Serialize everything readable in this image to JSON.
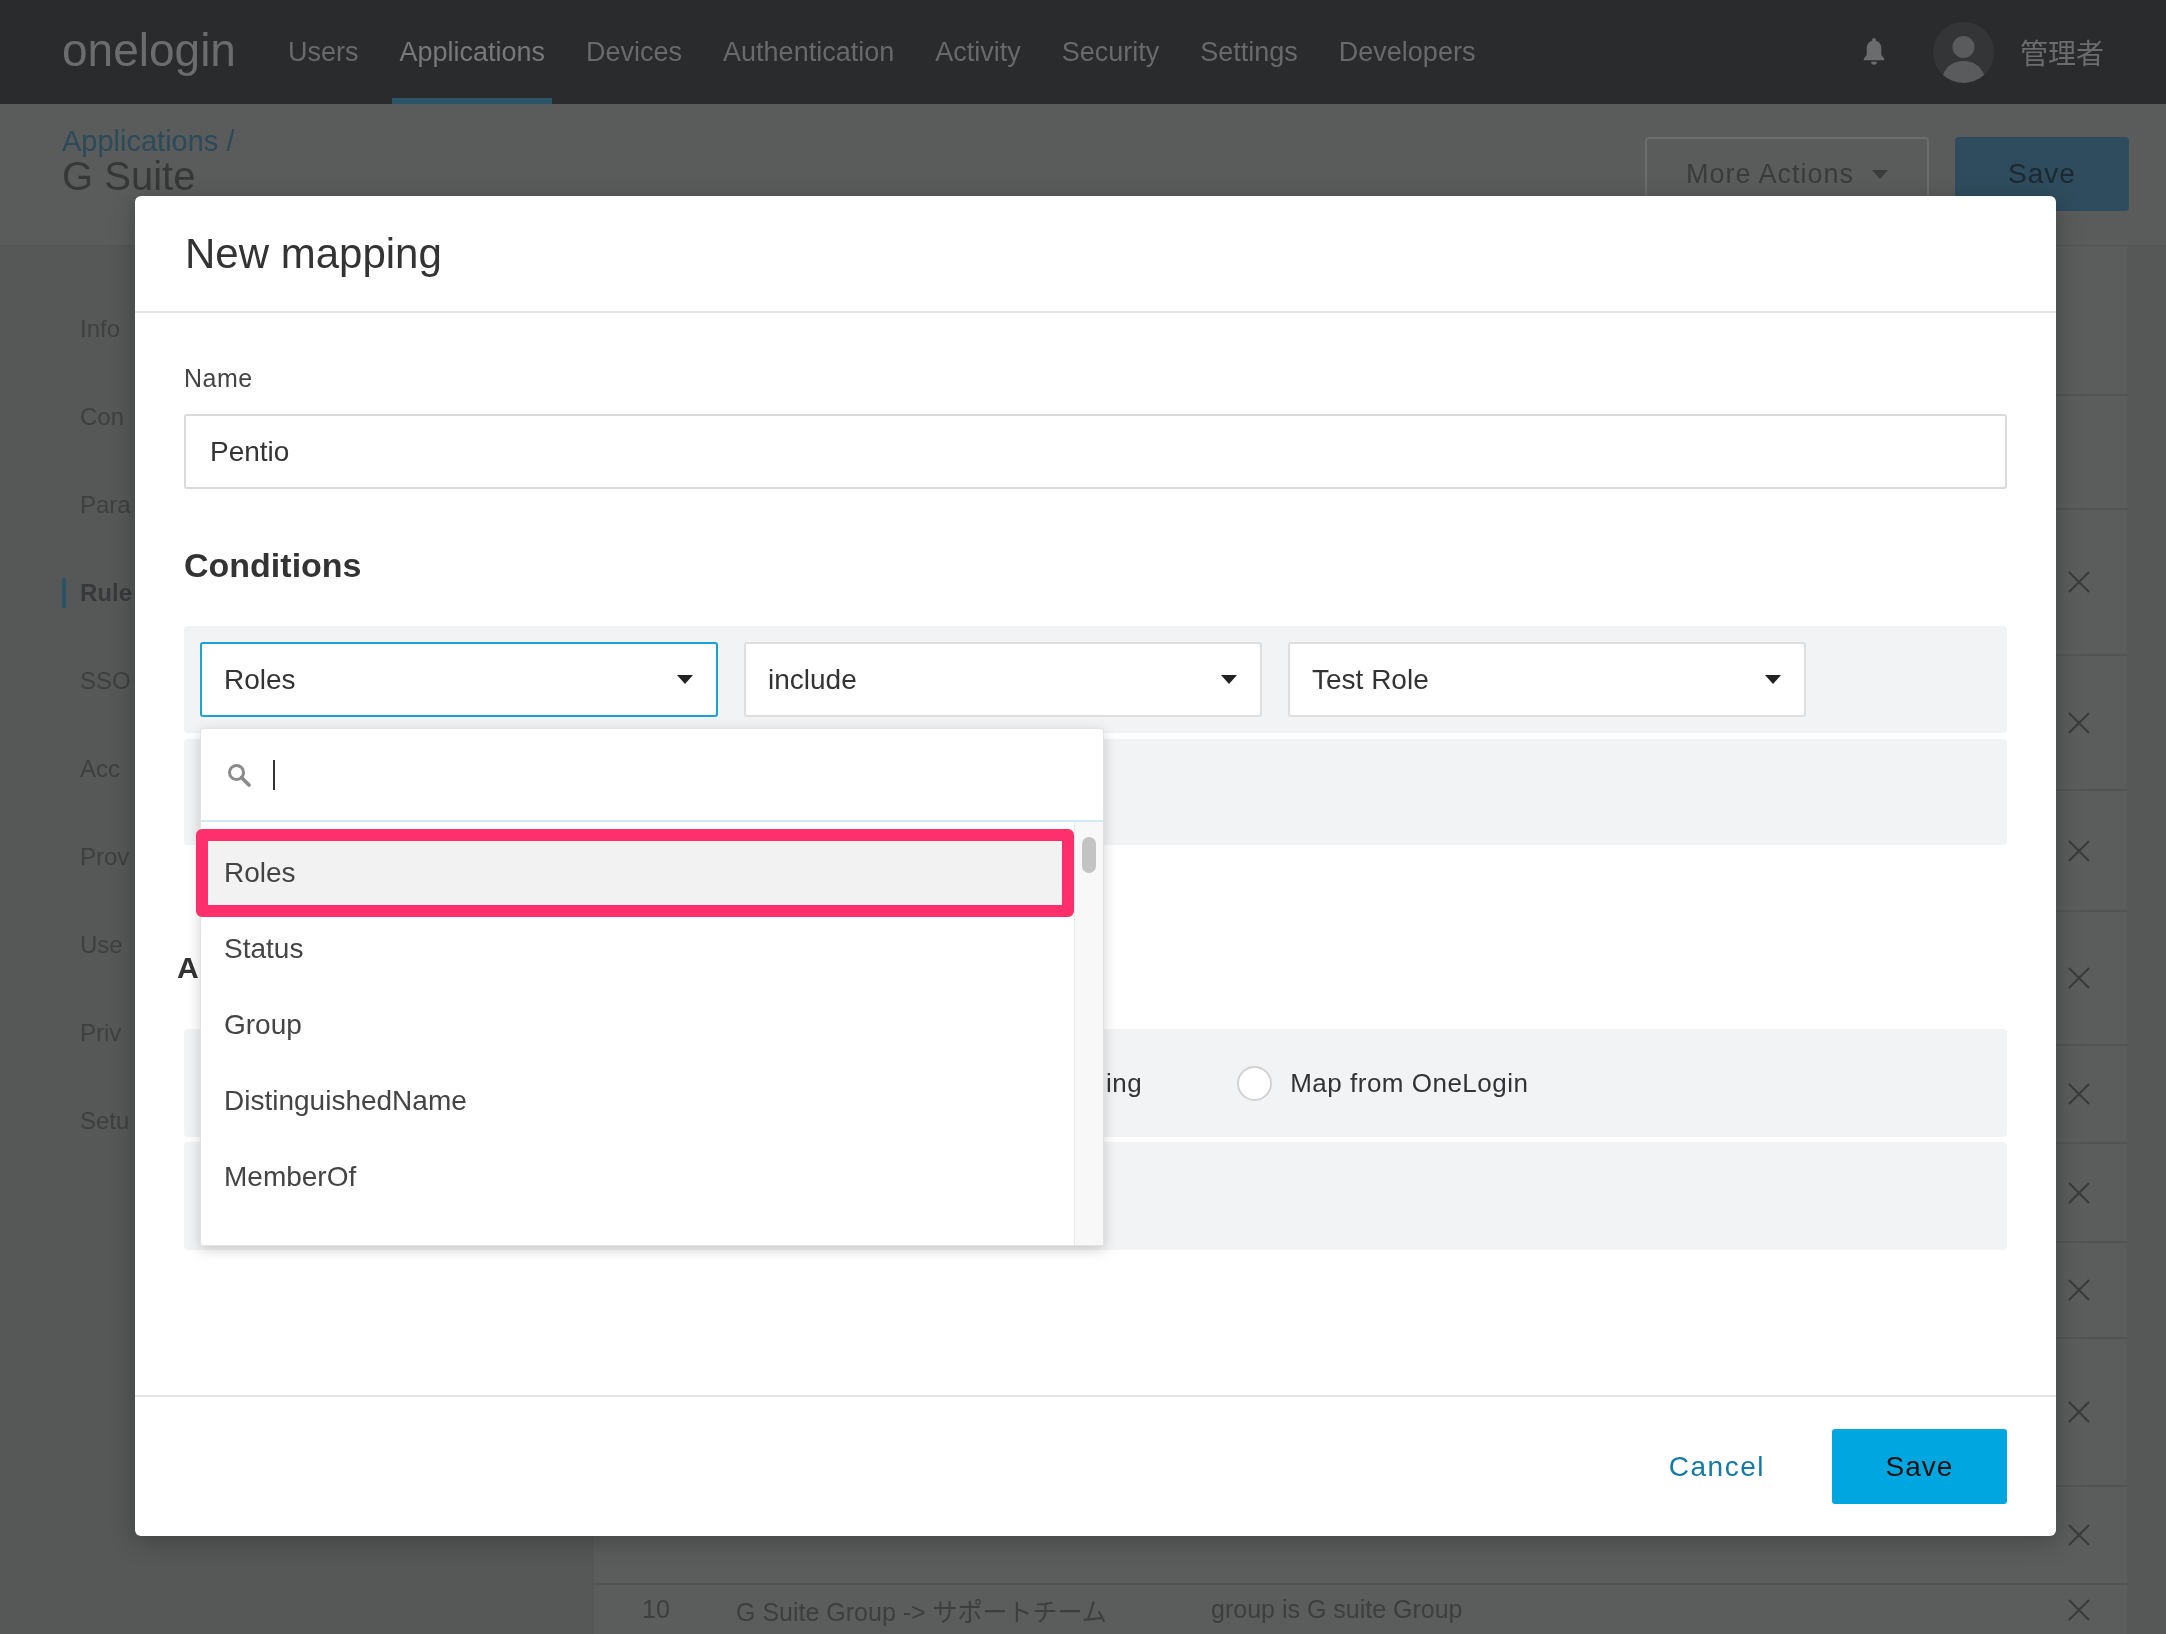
{
  "nav": {
    "logo": "onelogin",
    "items": [
      {
        "label": "Users",
        "selected": false
      },
      {
        "label": "Applications",
        "selected": true
      },
      {
        "label": "Devices",
        "selected": false
      },
      {
        "label": "Authentication",
        "selected": false
      },
      {
        "label": "Activity",
        "selected": false
      },
      {
        "label": "Security",
        "selected": false
      },
      {
        "label": "Settings",
        "selected": false
      },
      {
        "label": "Developers",
        "selected": false
      }
    ],
    "user_name": "管理者"
  },
  "page": {
    "breadcrumb": "Applications /",
    "title": "G Suite",
    "more_actions": "More Actions",
    "save": "Save"
  },
  "sidebar": {
    "items": [
      {
        "label": "Info",
        "selected": false
      },
      {
        "label": "Con",
        "selected": false
      },
      {
        "label": "Para",
        "selected": false
      },
      {
        "label": "Rule",
        "selected": true
      },
      {
        "label": "SSO",
        "selected": false
      },
      {
        "label": "Acc",
        "selected": false
      },
      {
        "label": "Prov",
        "selected": false
      },
      {
        "label": "Use",
        "selected": false
      },
      {
        "label": "Priv",
        "selected": false
      },
      {
        "label": "Setu",
        "selected": false
      }
    ]
  },
  "rules_table": {
    "rows": [
      {
        "number": "10",
        "name": "G Suite Group -> サポートチーム",
        "condition": "group is G suite Group"
      }
    ]
  },
  "modal": {
    "title": "New mapping",
    "name_label": "Name",
    "name_value": "Pentio",
    "conditions_heading": "Conditions",
    "condition": [
      {
        "value": "Roles",
        "focused": true
      },
      {
        "value": "include",
        "focused": false
      },
      {
        "value": "Test Role",
        "focused": false
      }
    ],
    "field_menu": {
      "options": [
        {
          "label": "Roles",
          "selected": true,
          "highlighted": true
        },
        {
          "label": "Status",
          "selected": false,
          "highlighted": false
        },
        {
          "label": "Group",
          "selected": false,
          "highlighted": false
        },
        {
          "label": "DistinguishedName",
          "selected": false,
          "highlighted": false
        },
        {
          "label": "MemberOf",
          "selected": false,
          "highlighted": false
        }
      ]
    },
    "actions_heading": "A",
    "actions": [
      {
        "kind": "label",
        "label": "ing"
      },
      {
        "kind": "radio",
        "label": "Map from OneLogin",
        "selected": false
      }
    ],
    "cancel": "Cancel",
    "save": "Save"
  }
}
